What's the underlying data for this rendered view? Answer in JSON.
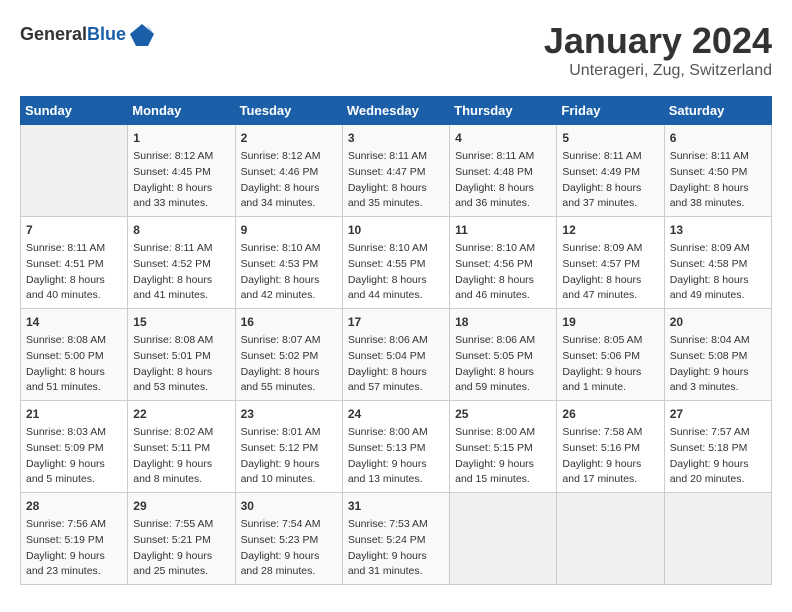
{
  "header": {
    "logo_general": "General",
    "logo_blue": "Blue",
    "month_title": "January 2024",
    "location": "Unterageri, Zug, Switzerland"
  },
  "weekdays": [
    "Sunday",
    "Monday",
    "Tuesday",
    "Wednesday",
    "Thursday",
    "Friday",
    "Saturday"
  ],
  "weeks": [
    [
      {
        "day": "",
        "content": ""
      },
      {
        "day": "1",
        "content": "Sunrise: 8:12 AM\nSunset: 4:45 PM\nDaylight: 8 hours\nand 33 minutes."
      },
      {
        "day": "2",
        "content": "Sunrise: 8:12 AM\nSunset: 4:46 PM\nDaylight: 8 hours\nand 34 minutes."
      },
      {
        "day": "3",
        "content": "Sunrise: 8:11 AM\nSunset: 4:47 PM\nDaylight: 8 hours\nand 35 minutes."
      },
      {
        "day": "4",
        "content": "Sunrise: 8:11 AM\nSunset: 4:48 PM\nDaylight: 8 hours\nand 36 minutes."
      },
      {
        "day": "5",
        "content": "Sunrise: 8:11 AM\nSunset: 4:49 PM\nDaylight: 8 hours\nand 37 minutes."
      },
      {
        "day": "6",
        "content": "Sunrise: 8:11 AM\nSunset: 4:50 PM\nDaylight: 8 hours\nand 38 minutes."
      }
    ],
    [
      {
        "day": "7",
        "content": "Sunrise: 8:11 AM\nSunset: 4:51 PM\nDaylight: 8 hours\nand 40 minutes."
      },
      {
        "day": "8",
        "content": "Sunrise: 8:11 AM\nSunset: 4:52 PM\nDaylight: 8 hours\nand 41 minutes."
      },
      {
        "day": "9",
        "content": "Sunrise: 8:10 AM\nSunset: 4:53 PM\nDaylight: 8 hours\nand 42 minutes."
      },
      {
        "day": "10",
        "content": "Sunrise: 8:10 AM\nSunset: 4:55 PM\nDaylight: 8 hours\nand 44 minutes."
      },
      {
        "day": "11",
        "content": "Sunrise: 8:10 AM\nSunset: 4:56 PM\nDaylight: 8 hours\nand 46 minutes."
      },
      {
        "day": "12",
        "content": "Sunrise: 8:09 AM\nSunset: 4:57 PM\nDaylight: 8 hours\nand 47 minutes."
      },
      {
        "day": "13",
        "content": "Sunrise: 8:09 AM\nSunset: 4:58 PM\nDaylight: 8 hours\nand 49 minutes."
      }
    ],
    [
      {
        "day": "14",
        "content": "Sunrise: 8:08 AM\nSunset: 5:00 PM\nDaylight: 8 hours\nand 51 minutes."
      },
      {
        "day": "15",
        "content": "Sunrise: 8:08 AM\nSunset: 5:01 PM\nDaylight: 8 hours\nand 53 minutes."
      },
      {
        "day": "16",
        "content": "Sunrise: 8:07 AM\nSunset: 5:02 PM\nDaylight: 8 hours\nand 55 minutes."
      },
      {
        "day": "17",
        "content": "Sunrise: 8:06 AM\nSunset: 5:04 PM\nDaylight: 8 hours\nand 57 minutes."
      },
      {
        "day": "18",
        "content": "Sunrise: 8:06 AM\nSunset: 5:05 PM\nDaylight: 8 hours\nand 59 minutes."
      },
      {
        "day": "19",
        "content": "Sunrise: 8:05 AM\nSunset: 5:06 PM\nDaylight: 9 hours\nand 1 minute."
      },
      {
        "day": "20",
        "content": "Sunrise: 8:04 AM\nSunset: 5:08 PM\nDaylight: 9 hours\nand 3 minutes."
      }
    ],
    [
      {
        "day": "21",
        "content": "Sunrise: 8:03 AM\nSunset: 5:09 PM\nDaylight: 9 hours\nand 5 minutes."
      },
      {
        "day": "22",
        "content": "Sunrise: 8:02 AM\nSunset: 5:11 PM\nDaylight: 9 hours\nand 8 minutes."
      },
      {
        "day": "23",
        "content": "Sunrise: 8:01 AM\nSunset: 5:12 PM\nDaylight: 9 hours\nand 10 minutes."
      },
      {
        "day": "24",
        "content": "Sunrise: 8:00 AM\nSunset: 5:13 PM\nDaylight: 9 hours\nand 13 minutes."
      },
      {
        "day": "25",
        "content": "Sunrise: 8:00 AM\nSunset: 5:15 PM\nDaylight: 9 hours\nand 15 minutes."
      },
      {
        "day": "26",
        "content": "Sunrise: 7:58 AM\nSunset: 5:16 PM\nDaylight: 9 hours\nand 17 minutes."
      },
      {
        "day": "27",
        "content": "Sunrise: 7:57 AM\nSunset: 5:18 PM\nDaylight: 9 hours\nand 20 minutes."
      }
    ],
    [
      {
        "day": "28",
        "content": "Sunrise: 7:56 AM\nSunset: 5:19 PM\nDaylight: 9 hours\nand 23 minutes."
      },
      {
        "day": "29",
        "content": "Sunrise: 7:55 AM\nSunset: 5:21 PM\nDaylight: 9 hours\nand 25 minutes."
      },
      {
        "day": "30",
        "content": "Sunrise: 7:54 AM\nSunset: 5:23 PM\nDaylight: 9 hours\nand 28 minutes."
      },
      {
        "day": "31",
        "content": "Sunrise: 7:53 AM\nSunset: 5:24 PM\nDaylight: 9 hours\nand 31 minutes."
      },
      {
        "day": "",
        "content": ""
      },
      {
        "day": "",
        "content": ""
      },
      {
        "day": "",
        "content": ""
      }
    ]
  ]
}
